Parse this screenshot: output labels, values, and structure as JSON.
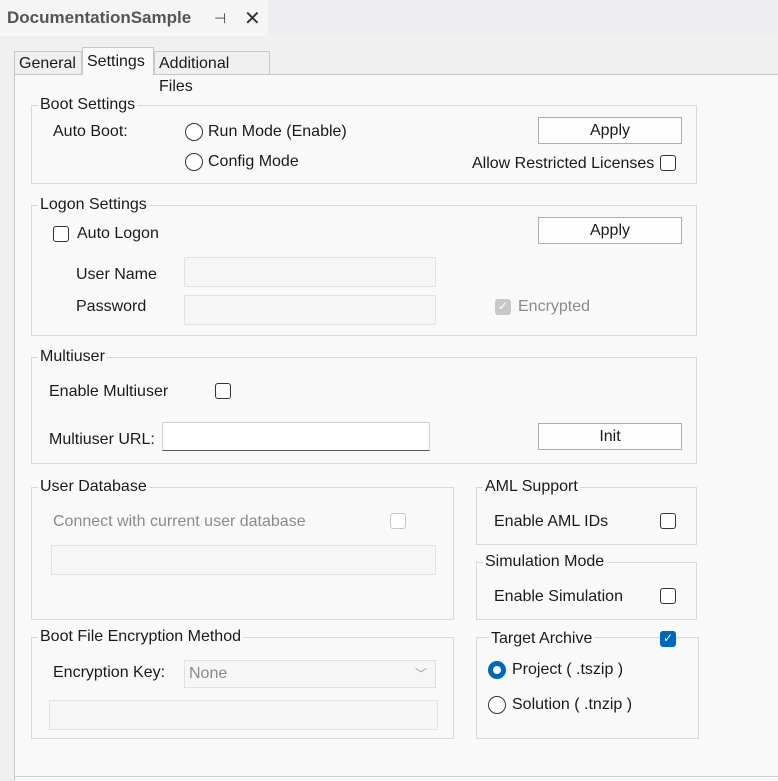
{
  "doc_tab": {
    "title": "DocumentationSample",
    "pin_glyph": "⊣",
    "close_glyph": "✕"
  },
  "tabs": [
    {
      "label": "General"
    },
    {
      "label": "Settings"
    },
    {
      "label": "Additional Files"
    }
  ],
  "boot_settings": {
    "title": "Boot Settings",
    "auto_boot_label": "Auto Boot:",
    "run_mode_label": "Run Mode (Enable)",
    "config_mode_label": "Config Mode",
    "apply_label": "Apply",
    "allow_restricted_label": "Allow Restricted Licenses"
  },
  "logon_settings": {
    "title": "Logon Settings",
    "auto_logon_label": "Auto Logon",
    "apply_label": "Apply",
    "user_name_label": "User Name",
    "user_name_value": "",
    "password_label": "Password",
    "password_value": "",
    "encrypted_label": "Encrypted"
  },
  "multiuser": {
    "title": "Multiuser",
    "enable_label": "Enable Multiuser",
    "url_label": "Multiuser URL:",
    "url_value": "",
    "init_label": "Init"
  },
  "user_database": {
    "title": "User Database",
    "connect_label": "Connect with current user database",
    "db_value": ""
  },
  "aml_support": {
    "title": "AML Support",
    "enable_label": "Enable AML IDs"
  },
  "simulation_mode": {
    "title": "Simulation Mode",
    "enable_label": "Enable Simulation"
  },
  "boot_file_encryption": {
    "title": "Boot File Encryption Method",
    "key_label": "Encryption Key:",
    "key_value": "None",
    "extra_value": ""
  },
  "target_archive": {
    "title": "Target Archive",
    "project_label": "Project ( .tszip )",
    "solution_label": "Solution ( .tnzip )"
  },
  "colors": {
    "accent": "#0067c0"
  }
}
